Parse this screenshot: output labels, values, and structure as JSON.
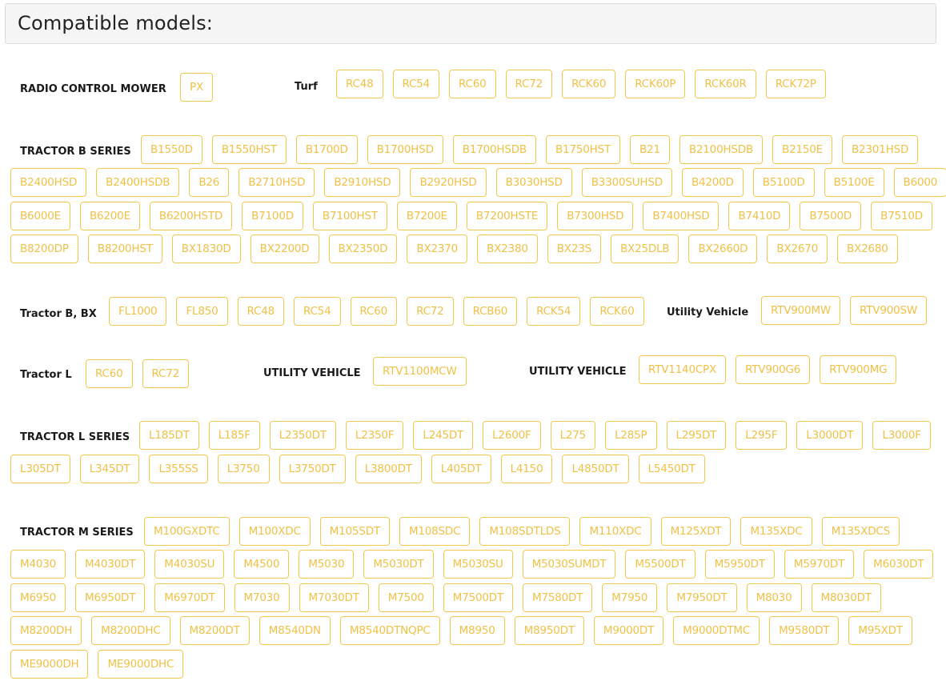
{
  "header": {
    "title": "Compatible models:"
  },
  "groups": [
    {
      "label": "RADIO CONTROL MOWER",
      "models": [
        "PX"
      ]
    },
    {
      "label": "Turf",
      "models": [
        "RC48",
        "RC54",
        "RC60",
        "RC72",
        "RCK60",
        "RCK60P",
        "RCK60R",
        "RCK72P"
      ]
    },
    {
      "label": "TRACTOR B SERIES",
      "models": [
        "B1550D",
        "B1550HST",
        "B1700D",
        "B1700HSD",
        "B1700HSDB",
        "B1750HST",
        "B21",
        "B2100HSDB",
        "B2150E",
        "B2301HSD",
        "B2400HSD",
        "B2400HSDB",
        "B26",
        "B2710HSD",
        "B2910HSD",
        "B2920HSD",
        "B3030HSD",
        "B3300SUHSD",
        "B4200D",
        "B5100D",
        "B5100E",
        "B6000",
        "B6000E",
        "B6200E",
        "B6200HSTD",
        "B7100D",
        "B7100HST",
        "B7200E",
        "B7200HSTE",
        "B7300HSD",
        "B7400HSD",
        "B7410D",
        "B7500D",
        "B7510D",
        "B8200DP",
        "B8200HST",
        "BX1830D",
        "BX2200D",
        "BX2350D",
        "BX2370",
        "BX2380",
        "BX23S",
        "BX25DLB",
        "BX2660D",
        "BX2670",
        "BX2680"
      ]
    },
    {
      "label": "Tractor B, BX",
      "models": [
        "FL1000",
        "FL850",
        "RC48",
        "RC54",
        "RC60",
        "RC72",
        "RCB60",
        "RCK54",
        "RCK60"
      ]
    },
    {
      "label": "Utility Vehicle",
      "models": [
        "RTV900MW",
        "RTV900SW"
      ]
    },
    {
      "label": "Tractor L",
      "models": [
        "RC60",
        "RC72"
      ]
    },
    {
      "label": "UTILITY VEHICLE",
      "models": [
        "RTV1100MCW"
      ]
    },
    {
      "label": "UTILITY VEHICLE",
      "models": [
        "RTV1140CPX",
        "RTV900G6",
        "RTV900MG"
      ]
    },
    {
      "label": "TRACTOR L SERIES",
      "models": [
        "L185DT",
        "L185F",
        "L2350DT",
        "L2350F",
        "L245DT",
        "L2600F",
        "L275",
        "L285P",
        "L295DT",
        "L295F",
        "L3000DT",
        "L3000F",
        "L305DT",
        "L345DT",
        "L355SS",
        "L3750",
        "L3750DT",
        "L3800DT",
        "L405DT",
        "L4150",
        "L4850DT",
        "L5450DT"
      ]
    },
    {
      "label": "TRACTOR M SERIES",
      "models": [
        "M100GXDTC",
        "M100XDC",
        "M105SDT",
        "M108SDC",
        "M108SDTLDS",
        "M110XDC",
        "M125XDT",
        "M135XDC",
        "M135XDCS",
        "M4030",
        "M4030DT",
        "M4030SU",
        "M4500",
        "M5030",
        "M5030DT",
        "M5030SU",
        "M5030SUMDT",
        "M5500DT",
        "M5950DT",
        "M5970DT",
        "M6030DT",
        "M6950",
        "M6950DT",
        "M6970DT",
        "M7030",
        "M7030DT",
        "M7500",
        "M7500DT",
        "M7580DT",
        "M7950",
        "M7950DT",
        "M8030",
        "M8030DT",
        "M8200DH",
        "M8200DHC",
        "M8200DT",
        "M8540DN",
        "M8540DTNQPC",
        "M8950",
        "M8950DT",
        "M9000DT",
        "M9000DTMC",
        "M9580DT",
        "M95XDT",
        "ME9000DH",
        "ME9000DHC"
      ]
    }
  ]
}
